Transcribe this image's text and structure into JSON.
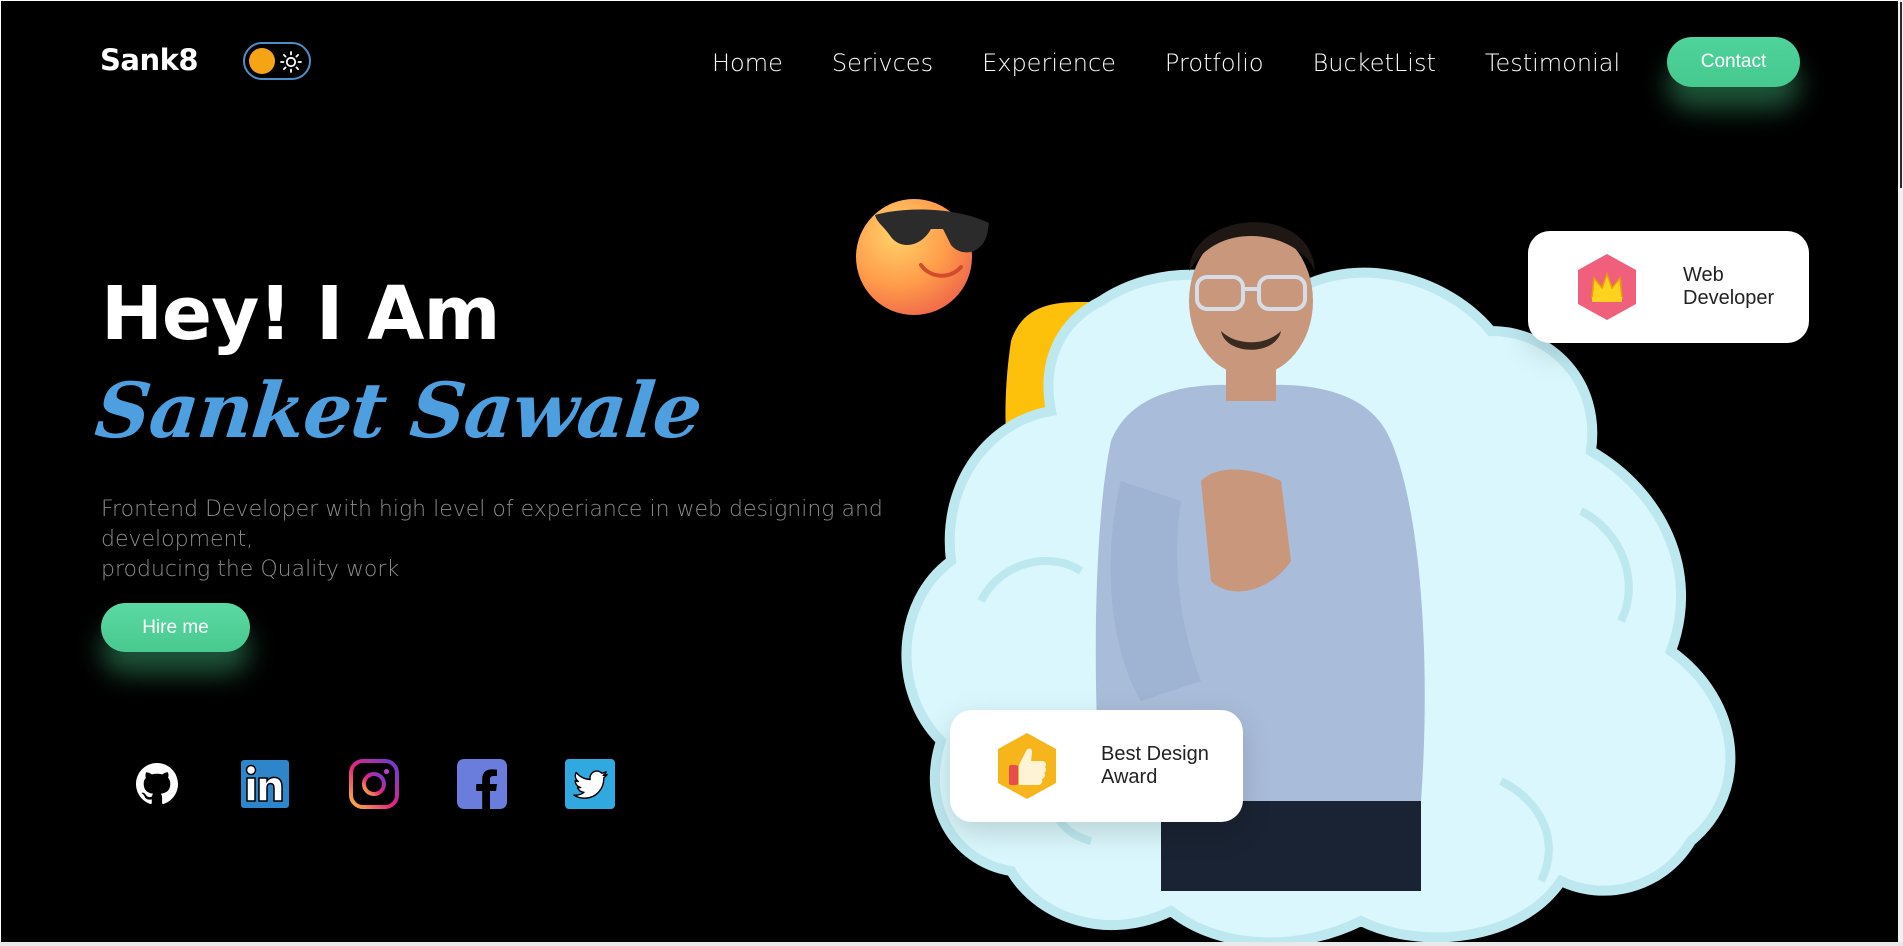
{
  "header": {
    "logo": "Sank8",
    "theme_toggle": {
      "state": "dark",
      "knob_color": "#f5a416",
      "border_color": "#4a90c8"
    },
    "nav": [
      {
        "label": "Home"
      },
      {
        "label": "Serivces"
      },
      {
        "label": "Experience"
      },
      {
        "label": "Protfolio"
      },
      {
        "label": "BucketList"
      },
      {
        "label": "Testimonial"
      }
    ],
    "contact_label": "Contact"
  },
  "hero": {
    "greeting": "Hey! I Am",
    "name": "Sanket Sawale",
    "description_line1": "Frontend Developer with high level of experiance in web designing and development,",
    "description_line2": "producing the Quality work",
    "hire_label": "Hire me"
  },
  "socials": [
    {
      "icon": "github-icon"
    },
    {
      "icon": "linkedin-icon"
    },
    {
      "icon": "instagram-icon"
    },
    {
      "icon": "facebook-icon"
    },
    {
      "icon": "twitter-icon"
    }
  ],
  "cards": {
    "web": {
      "line1": "Web",
      "line2": "Developer",
      "icon": "crown-icon"
    },
    "award": {
      "line1": "Best Design",
      "line2": "Award",
      "icon": "thumbs-up-icon"
    }
  },
  "colors": {
    "background": "#000000",
    "accent_green": "#4fd39c",
    "name_blue": "#4d9fe0",
    "blob_yellow": "#fdc10c",
    "cloud_blue": "#d8f6fb"
  }
}
